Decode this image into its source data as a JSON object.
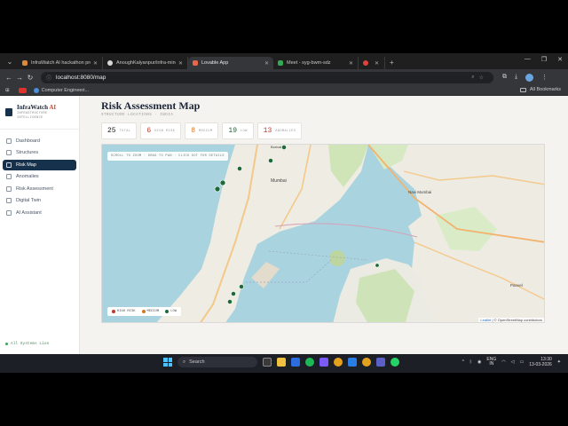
{
  "browser": {
    "tabs": [
      {
        "title": "InfraWatch AI hackathon proje",
        "color": "#d98a3c",
        "active": false
      },
      {
        "title": "AnoughKalyanpur/infra-mind-v",
        "color": "#d8d8d8",
        "active": false
      },
      {
        "title": "Lovable App",
        "color": "#e8674a",
        "active": true
      },
      {
        "title": "Meet - syg-bwm-sdz",
        "color": "#34a853",
        "active": false
      },
      {
        "title": "",
        "color": "#e0413a",
        "active": false
      }
    ],
    "url": "localhost:8080/map",
    "bookmark": "Computer Engineeri...",
    "all_bookmarks": "All Bookmarks"
  },
  "app": {
    "brand": "InfraWatch",
    "brand_ai": "AI",
    "brand_sub_1": "INFRASTRUCTURE",
    "brand_sub_2": "INTELLIGENCE",
    "nav": [
      {
        "label": "Dashboard",
        "icon": "grid-icon",
        "active": false
      },
      {
        "label": "Structures",
        "icon": "building-icon",
        "active": false
      },
      {
        "label": "Risk Map",
        "icon": "map-icon",
        "active": true
      },
      {
        "label": "Anomalies",
        "icon": "alert-icon",
        "active": false
      },
      {
        "label": "Risk Assessment",
        "icon": "shield-icon",
        "active": false
      },
      {
        "label": "Digital Twin",
        "icon": "cube-icon",
        "active": false
      },
      {
        "label": "AI Assistant",
        "icon": "chat-icon",
        "active": false
      }
    ],
    "status": "All Systems Live"
  },
  "page": {
    "title": "Risk Assessment Map",
    "subtitle": "STRUCTURE LOCATIONS · INDIA",
    "stats": [
      {
        "value": "25",
        "label": "TOTAL",
        "color": "#222222"
      },
      {
        "value": "6",
        "label": "HIGH RISK",
        "color": "#c0392b"
      },
      {
        "value": "8",
        "label": "MEDIUM",
        "color": "#d4781e"
      },
      {
        "value": "19",
        "label": "LOW",
        "color": "#1e6b3a"
      },
      {
        "value": "13",
        "label": "ANOMALIES",
        "color": "#c0392b"
      }
    ]
  },
  "map": {
    "hint": "SCROLL TO ZOOM · DRAG TO PAN · CLICK DOT FOR DETAILS",
    "places": [
      "Mumbai",
      "Navi Mumbai",
      "Panvel",
      "Borivali"
    ],
    "legend": [
      {
        "label": "HIGH RISK",
        "color": "#c0392b"
      },
      {
        "label": "MEDIUM",
        "color": "#d4781e"
      },
      {
        "label": "LOW",
        "color": "#1e6b3a"
      }
    ],
    "attribution_leaflet": "Leaflet",
    "attribution_rest": "| © OpenStreetMap contributors"
  },
  "taskbar": {
    "search": "Search",
    "lang_1": "ENG",
    "lang_2": "IN",
    "time": "13:30",
    "date": "13-03-2026"
  }
}
